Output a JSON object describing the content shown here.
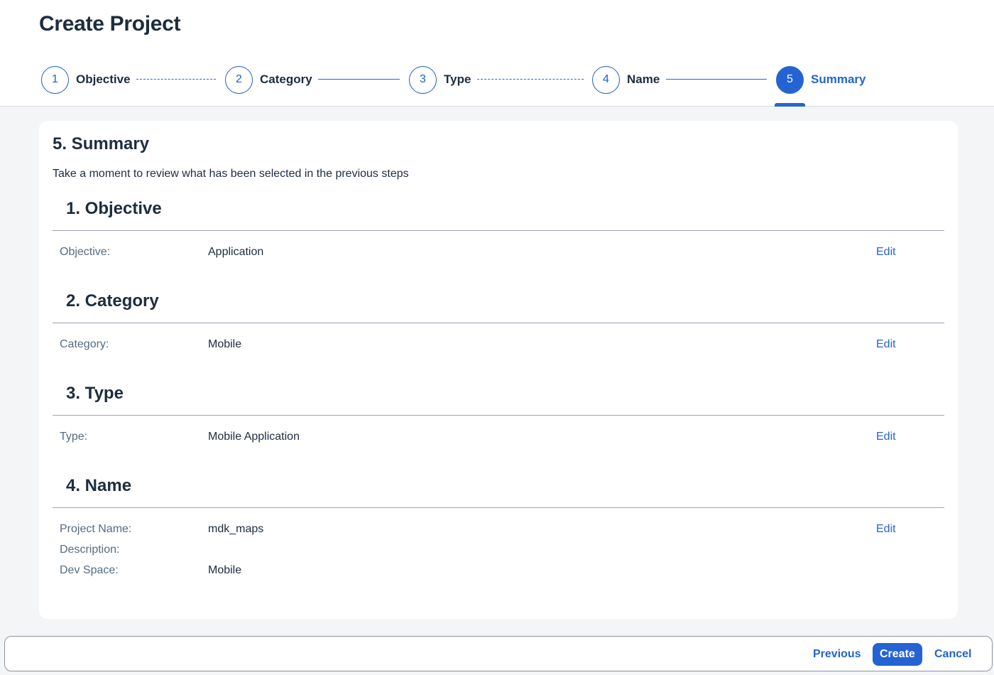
{
  "header": {
    "title": "Create Project"
  },
  "wizard": {
    "steps": [
      {
        "number": "1",
        "label": "Objective"
      },
      {
        "number": "2",
        "label": "Category"
      },
      {
        "number": "3",
        "label": "Type"
      },
      {
        "number": "4",
        "label": "Name"
      },
      {
        "number": "5",
        "label": "Summary",
        "active": true
      }
    ]
  },
  "summary": {
    "title": "5. Summary",
    "description": "Take a moment to review what has been selected in the previous steps",
    "edit_label": "Edit",
    "sections": [
      {
        "title": "1. Objective",
        "rows": [
          {
            "label": "Objective:",
            "value": "Application"
          }
        ]
      },
      {
        "title": "2. Category",
        "rows": [
          {
            "label": "Category:",
            "value": "Mobile"
          }
        ]
      },
      {
        "title": "3. Type",
        "rows": [
          {
            "label": "Type:",
            "value": "Mobile Application"
          }
        ]
      },
      {
        "title": "4. Name",
        "rows": [
          {
            "label": "Project Name:",
            "value": "mdk_maps"
          },
          {
            "label": "Description:",
            "value": ""
          },
          {
            "label": "Dev Space:",
            "value": "Mobile"
          }
        ]
      }
    ]
  },
  "footer": {
    "previous_label": "Previous",
    "create_label": "Create",
    "cancel_label": "Cancel"
  },
  "colors": {
    "accent": "#2364d2",
    "text": "#1d2d3e",
    "muted_label": "#556b82",
    "background": "#f4f5f7"
  }
}
